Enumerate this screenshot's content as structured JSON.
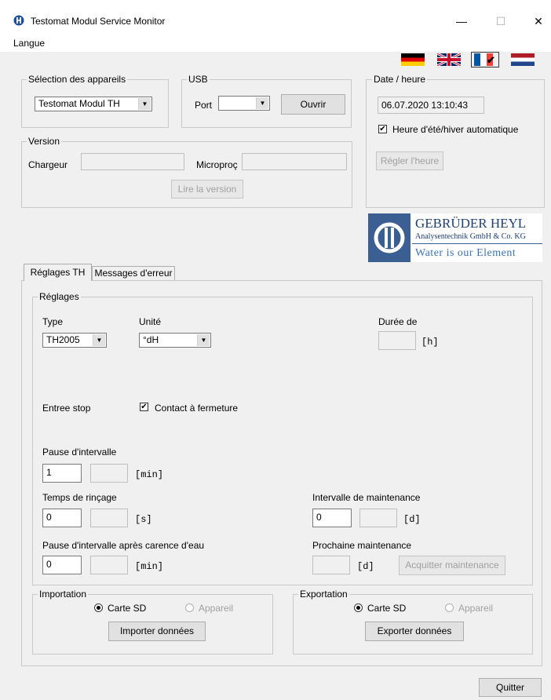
{
  "window": {
    "title": "Testomat Modul Service Monitor",
    "minimize": "—",
    "maximize": "☐",
    "close": "✕"
  },
  "menu": {
    "langue": "Langue"
  },
  "flags": [
    "Deutsch",
    "English",
    "Français",
    "Nederlands"
  ],
  "device_select": {
    "legend": "Sélection des appareils",
    "value": "Testomat Modul TH"
  },
  "usb": {
    "legend": "USB",
    "port_label": "Port",
    "port_value": "",
    "open_button": "Ouvrir"
  },
  "datetime": {
    "legend": "Date / heure",
    "value": "06.07.2020  13:10:43",
    "dst_label": "Heure d'été/hiver automatique",
    "dst_checked": true,
    "set_button": "Régler l'heure"
  },
  "version": {
    "legend": "Version",
    "loader_label": "Chargeur",
    "loader_value": "",
    "micro_label": "Microproç",
    "micro_value": "",
    "read_button": "Lire la version"
  },
  "logo": {
    "name": "GEBRÜDER HEYL",
    "sub": "Analysentechnik GmbH & Co. KG",
    "slogan": "Water is our Element"
  },
  "tabs": [
    "Réglages TH",
    "Messages d'erreur"
  ],
  "settings": {
    "legend": "Réglages",
    "type_label": "Type",
    "type_value": "TH2005",
    "unit_label": "Unité",
    "unit_value": "°dH",
    "duration_label": "Durée de",
    "duration_value": "",
    "duration_unit": "[h]",
    "stop_label": "Entree stop",
    "contact_label": "Contact à fermeture",
    "contact_checked": true,
    "pause_label": "Pause d'intervalle",
    "pause_value": "1",
    "pause_value2": "",
    "pause_unit": "[min]",
    "rinse_label": "Temps de rinçage",
    "rinse_value": "0",
    "rinse_value2": "",
    "rinse_unit": "[s]",
    "maint_label": "Intervalle de maintenance",
    "maint_value": "0",
    "maint_value2": "",
    "maint_unit": "[d]",
    "pause_water_label": "Pause d'intervalle après carence d'eau",
    "pause_water_value": "0",
    "pause_water_value2": "",
    "pause_water_unit": "[min]",
    "next_maint_label": "Prochaine maintenance",
    "next_maint_value": "",
    "next_maint_unit": "[d]",
    "ack_button": "Acquitter maintenance"
  },
  "import": {
    "legend": "Importation",
    "sd_label": "Carte SD",
    "device_label": "Appareil",
    "button": "Importer données"
  },
  "export": {
    "legend": "Exportation",
    "sd_label": "Carte SD",
    "device_label": "Appareil",
    "button": "Exporter données"
  },
  "quit_button": "Quitter"
}
